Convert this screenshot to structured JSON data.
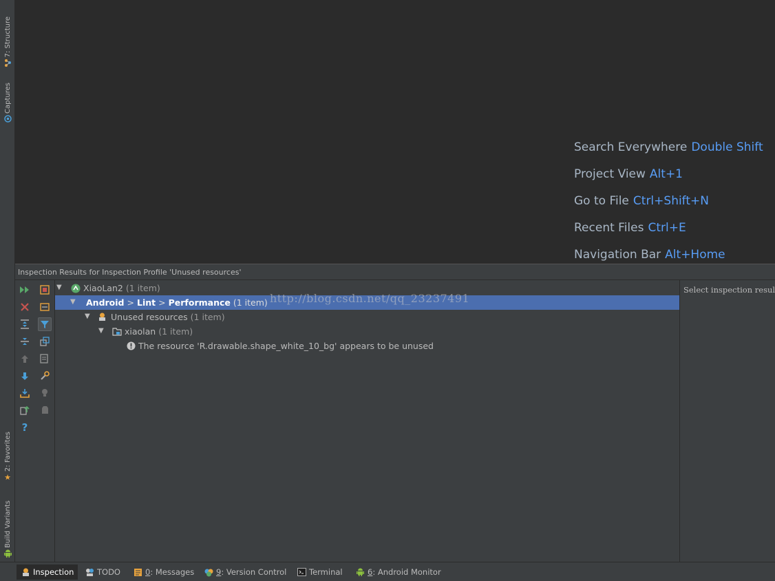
{
  "left_strip": {
    "tabs": [
      {
        "label": "7: Structure",
        "icon": "structure-icon"
      },
      {
        "label": "Captures",
        "icon": "captures-icon"
      },
      {
        "label": "2: Favorites",
        "icon": "star-icon"
      },
      {
        "label": "Build Variants",
        "icon": "android-icon"
      }
    ]
  },
  "editor": {
    "hints": [
      {
        "label": "Search Everywhere",
        "key": "Double Shift"
      },
      {
        "label": "Project View",
        "key": "Alt+1"
      },
      {
        "label": "Go to File",
        "key": "Ctrl+Shift+N"
      },
      {
        "label": "Recent Files",
        "key": "Ctrl+E"
      },
      {
        "label": "Navigation Bar",
        "key": "Alt+Home"
      }
    ]
  },
  "panel": {
    "title": "Inspection Results for Inspection Profile 'Unused resources'",
    "tree": {
      "root": {
        "name": "XiaoLan2",
        "count": "(1 item)"
      },
      "category": {
        "part1": "Android",
        "sep1": ">",
        "part2": "Lint",
        "sep2": ">",
        "part3": "Performance",
        "count": "(1 item)"
      },
      "group": {
        "name": "Unused resources",
        "count": "(1 item)"
      },
      "module": {
        "name": "xiaolan",
        "count": "(1 item)"
      },
      "problem": {
        "text": "The resource 'R.drawable.shape_white_10_bg' appears to be unused"
      }
    },
    "watermark": "http://blog.csdn.net/qq_23237491",
    "detail": {
      "text": "Select inspection result"
    }
  },
  "bottom_bar": {
    "tabs": [
      {
        "label": "Inspection",
        "mnemonic": "",
        "icon": "inspection-icon"
      },
      {
        "label": "TODO",
        "mnemonic": "",
        "icon": "todo-icon"
      },
      {
        "label": ": Messages",
        "mnemonic": "0",
        "icon": "messages-icon"
      },
      {
        "label": ": Version Control",
        "mnemonic": "9",
        "icon": "version-control-icon"
      },
      {
        "label": "Terminal",
        "mnemonic": "",
        "icon": "terminal-icon"
      },
      {
        "label": ": Android Monitor",
        "mnemonic": "6",
        "icon": "android-monitor-icon"
      }
    ]
  },
  "colors": {
    "editor_bg": "#2b2b2b",
    "panel_bg": "#3c3f41",
    "selection": "#4b6eaf",
    "shortcut": "#589df6",
    "hint_text": "#a9b7c6"
  }
}
